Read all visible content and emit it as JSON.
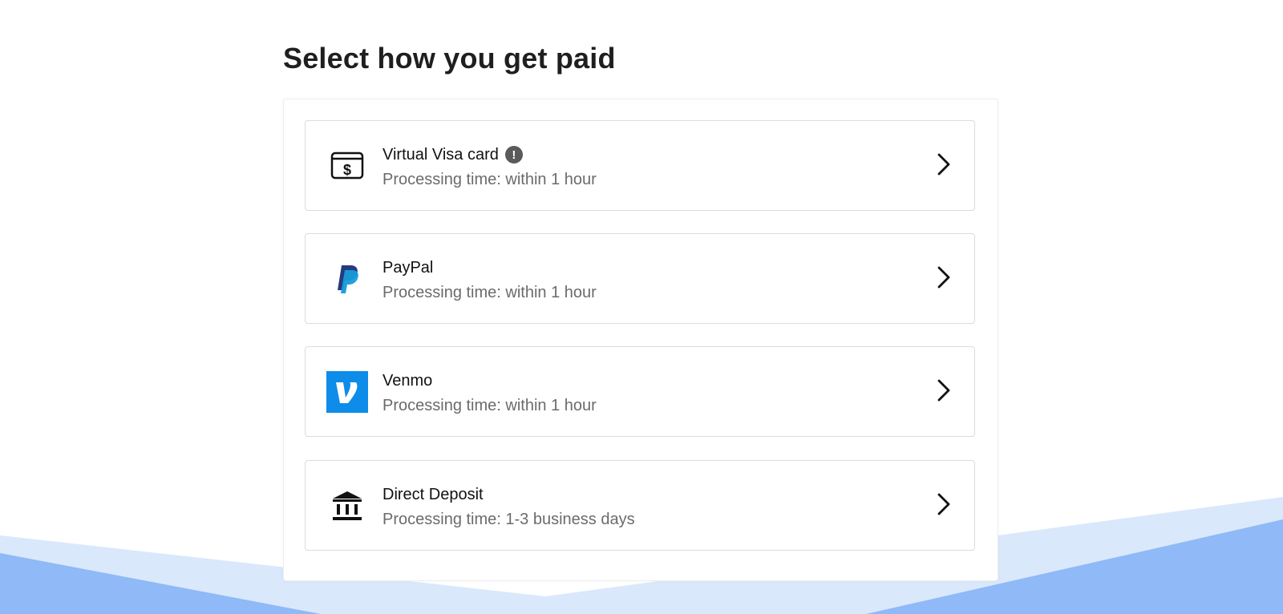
{
  "page": {
    "title": "Select how you get paid"
  },
  "options": [
    {
      "name": "Virtual Visa card",
      "processing": "Processing time: within 1 hour",
      "icon": "card-dollar-icon",
      "has_info": true
    },
    {
      "name": "PayPal",
      "processing": "Processing time: within 1 hour",
      "icon": "paypal-logo-icon"
    },
    {
      "name": "Venmo",
      "processing": "Processing time: within 1 hour",
      "icon": "venmo-logo-icon"
    },
    {
      "name": "Direct Deposit",
      "processing": "Processing time: 1-3 business days",
      "icon": "bank-icon"
    }
  ],
  "icons": {
    "info": "!",
    "chevron": "chevron-right-icon"
  },
  "colors": {
    "venmo_blue": "#0d8ce9",
    "paypal_dark": "#253b80",
    "paypal_light": "#179bd7",
    "wave_light": "#d9e8fb",
    "wave_dark": "#8fb9f7"
  }
}
